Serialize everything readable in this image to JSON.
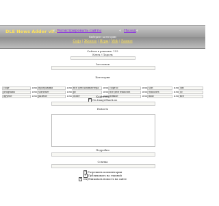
{
  "header": {
    "title": "DLE News Adder v5.1",
    "register_link": "Регистрировать сайты",
    "back_link": "Назад",
    "separator": "«",
    "subtitle": "Выберите категорию",
    "nav": [
      "Софт",
      "Железо",
      "Игры",
      "Web",
      "Разное"
    ]
  },
  "form": {
    "sites_info": "Сайтов в рекламе: 152",
    "key_label": "Ключ / Пароль",
    "title_label": "Заголовок",
    "categories_label": "Категории",
    "category_rows": [
      [
        {
          "text": "софт",
          "tag": "или"
        },
        {
          "text": "программы",
          "tag": "или"
        },
        {
          "text": "все для компьютера",
          "tag": "или"
        },
        {
          "text": "софтос",
          "tag": "или"
        },
        {
          "text": "soft",
          "tag": "или"
        },
        {
          "text": "сис",
          "tag": ""
        }
      ],
      [
        {
          "text": "programs",
          "tag": "или"
        },
        {
          "text": "software",
          "tag": "или"
        },
        {
          "text": "pc",
          "tag": "или"
        },
        {
          "text": "все для windows",
          "tag": "или"
        },
        {
          "text": "windows",
          "tag": "или"
        },
        {
          "text": "ос",
          "tag": ""
        }
      ],
      [
        {
          "text": "другое",
          "tag": "или"
        },
        {
          "text": "разное",
          "tag": "или"
        },
        {
          "text": "other",
          "tag": "или"
        },
        {
          "text": "всякое",
          "tag": "или"
        },
        {
          "text": "misc",
          "tag": "или"
        },
        {
          "text": "все",
          "tag": ""
        }
      ]
    ],
    "image_label": "Картинка",
    "image_checkbox_label": "На ImageShack.us",
    "news_label": "Новость",
    "more_label": "Подробно",
    "link_label": "Ссылка",
    "checks": [
      "Разрешить комментарии",
      "Публиковать на главной",
      "Опубликовать новость на сайте"
    ]
  }
}
